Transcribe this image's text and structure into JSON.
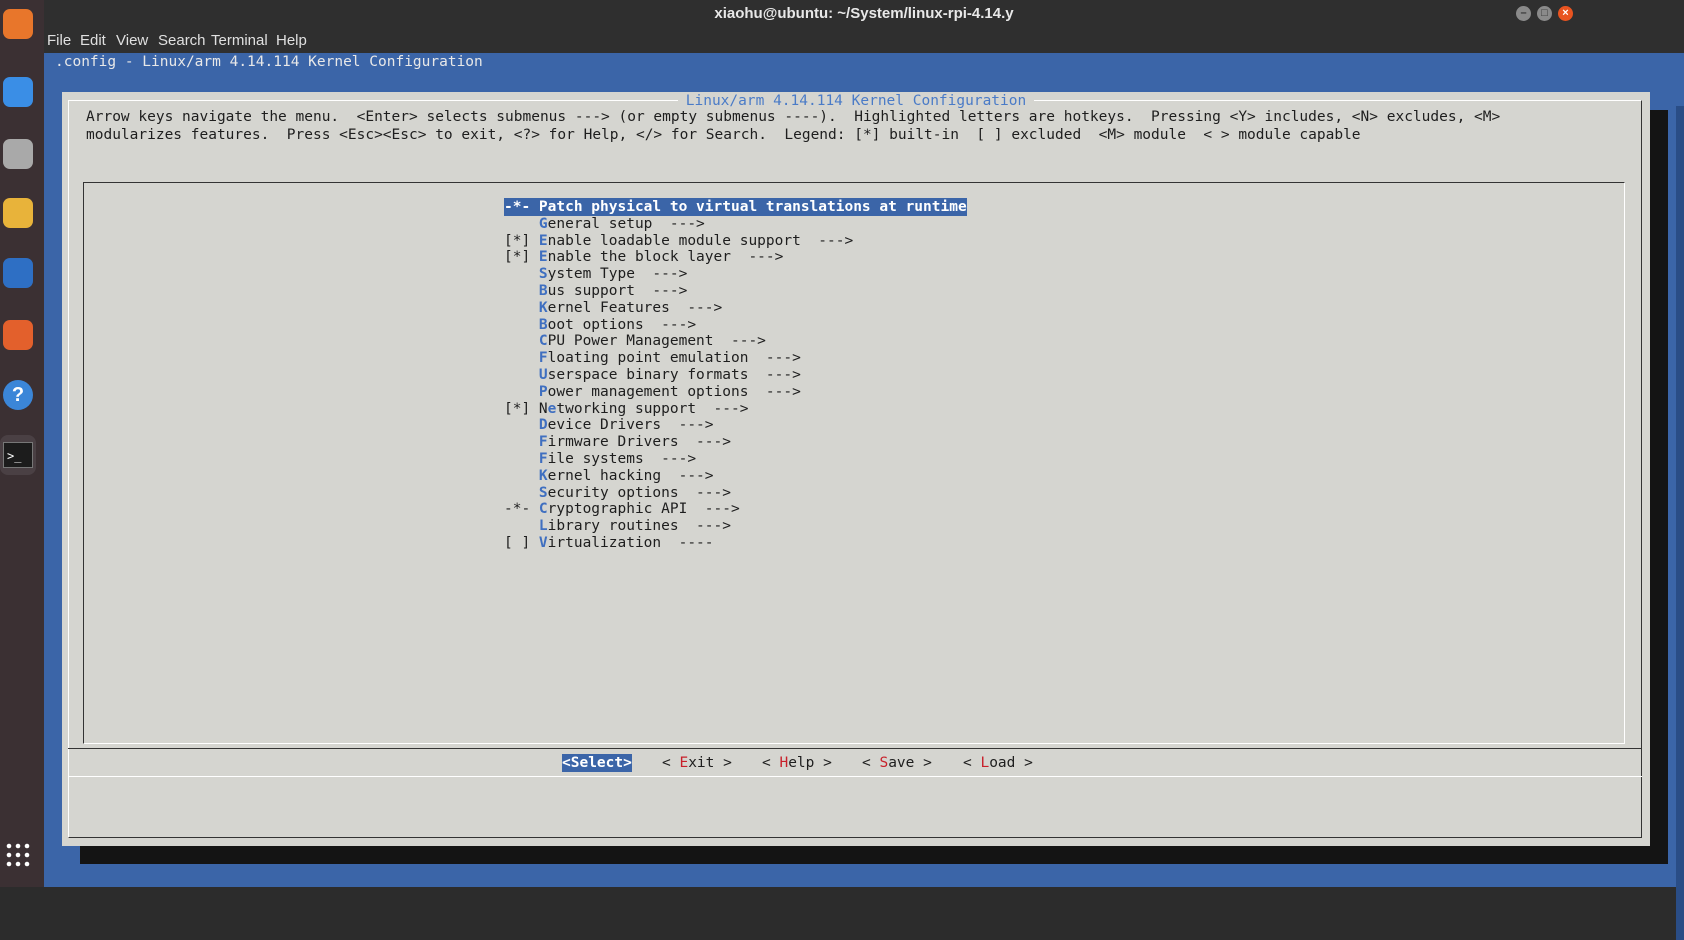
{
  "window": {
    "title": "xiaohu@ubuntu: ~/System/linux-rpi-4.14.y"
  },
  "menubar": {
    "items": [
      "File",
      "Edit",
      "View",
      "Search",
      "Terminal",
      "Help"
    ]
  },
  "dock": {
    "items": [
      {
        "name": "firefox-icon",
        "color": "#e8762b"
      },
      {
        "name": "thunderbird-icon",
        "color": "#3a8ee6"
      },
      {
        "name": "files-icon",
        "color": "#a9a9a9"
      },
      {
        "name": "rhythmbox-icon",
        "color": "#e8b33a"
      },
      {
        "name": "writer-icon",
        "color": "#2e6fc4"
      },
      {
        "name": "software-center-icon",
        "color": "#e3602c"
      },
      {
        "name": "help-icon",
        "color": "#3b86d8"
      },
      {
        "name": "terminal-icon",
        "color": "#2a2a2a"
      },
      {
        "name": "show-apps-icon",
        "color": "#ffffff"
      }
    ]
  },
  "terminal": {
    "config_title": ".config - Linux/arm 4.14.114 Kernel Configuration",
    "dialog_title": "Linux/arm 4.14.114 Kernel Configuration",
    "help_line1": "Arrow keys navigate the menu.  <Enter> selects submenus ---> (or empty submenus ----).  Highlighted letters are hotkeys.  Pressing <Y> includes, <N> excludes, <M>",
    "help_line2": "modularizes features.  Press <Esc><Esc> to exit, <?> for Help, </> for Search.  Legend: [*] built-in  [ ] excluded  <M> module  < > module capable",
    "menu_items": [
      {
        "prefix": "-*- ",
        "hotkey": "P",
        "rest": "atch physical to virtual translations at runtime",
        "selected": true
      },
      {
        "prefix": "    ",
        "hotkey": "G",
        "rest": "eneral setup  --->"
      },
      {
        "prefix": "[*] ",
        "hotkey": "E",
        "rest": "nable loadable module support  --->"
      },
      {
        "prefix": "[*] ",
        "hotkey": "E",
        "rest": "nable the block layer  --->"
      },
      {
        "prefix": "    ",
        "hotkey": "S",
        "rest": "ystem Type  --->"
      },
      {
        "prefix": "    ",
        "hotkey": "B",
        "rest": "us support  --->"
      },
      {
        "prefix": "    ",
        "hotkey": "K",
        "rest": "ernel Features  --->"
      },
      {
        "prefix": "    ",
        "hotkey": "B",
        "rest": "oot options  --->"
      },
      {
        "prefix": "    ",
        "hotkey": "C",
        "rest": "PU Power Management  --->"
      },
      {
        "prefix": "    ",
        "hotkey": "F",
        "rest": "loating point emulation  --->"
      },
      {
        "prefix": "    ",
        "hotkey": "U",
        "rest": "serspace binary formats  --->"
      },
      {
        "prefix": "    ",
        "hotkey": "P",
        "rest": "ower management options  --->"
      },
      {
        "prefix": "[*] ",
        "hotkey": "N",
        "rest": "etworking support  --->",
        "hotkey_pos": 1
      },
      {
        "prefix": "    ",
        "hotkey": "D",
        "rest": "evice Drivers  --->"
      },
      {
        "prefix": "    ",
        "hotkey": "F",
        "rest": "irmware Drivers  --->"
      },
      {
        "prefix": "    ",
        "hotkey": "F",
        "rest": "ile systems  --->"
      },
      {
        "prefix": "    ",
        "hotkey": "K",
        "rest": "ernel hacking  --->"
      },
      {
        "prefix": "    ",
        "hotkey": "S",
        "rest": "ecurity options  --->"
      },
      {
        "prefix": "-*- ",
        "hotkey": "C",
        "rest": "ryptographic API  --->"
      },
      {
        "prefix": "    ",
        "hotkey": "L",
        "rest": "ibrary routines  --->"
      },
      {
        "prefix": "[ ] ",
        "hotkey": "V",
        "rest": "irtualization  ----"
      }
    ],
    "buttons": [
      {
        "label": "<Select>",
        "active": true
      },
      {
        "pre": "< ",
        "hotkey": "E",
        "rest": "xit >"
      },
      {
        "pre": "< ",
        "hotkey": "H",
        "rest": "elp >"
      },
      {
        "pre": "< ",
        "hotkey": "S",
        "rest": "ave >"
      },
      {
        "pre": "< ",
        "hotkey": "L",
        "rest": "oad >"
      }
    ]
  }
}
